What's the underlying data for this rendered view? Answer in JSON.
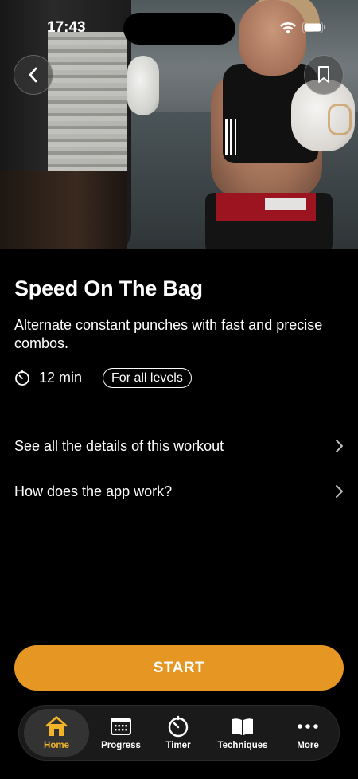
{
  "status_bar": {
    "time": "17:43"
  },
  "workout": {
    "title": "Speed On The Bag",
    "description": "Alternate constant punches with fast and precise combos.",
    "duration": "12 min",
    "level": "For all levels"
  },
  "links": [
    {
      "label": "See all the details of this workout"
    },
    {
      "label": "How does the app work?"
    }
  ],
  "start_label": "START",
  "tabs": [
    {
      "label": "Home",
      "icon": "home-icon",
      "active": true
    },
    {
      "label": "Progress",
      "icon": "calendar-icon",
      "active": false
    },
    {
      "label": "Timer",
      "icon": "timer-icon",
      "active": false
    },
    {
      "label": "Techniques",
      "icon": "book-icon",
      "active": false
    },
    {
      "label": "More",
      "icon": "more-dots-icon",
      "active": false
    }
  ],
  "colors": {
    "accent": "#e69723",
    "active_tab": "#f2b52a",
    "background": "#000000"
  }
}
